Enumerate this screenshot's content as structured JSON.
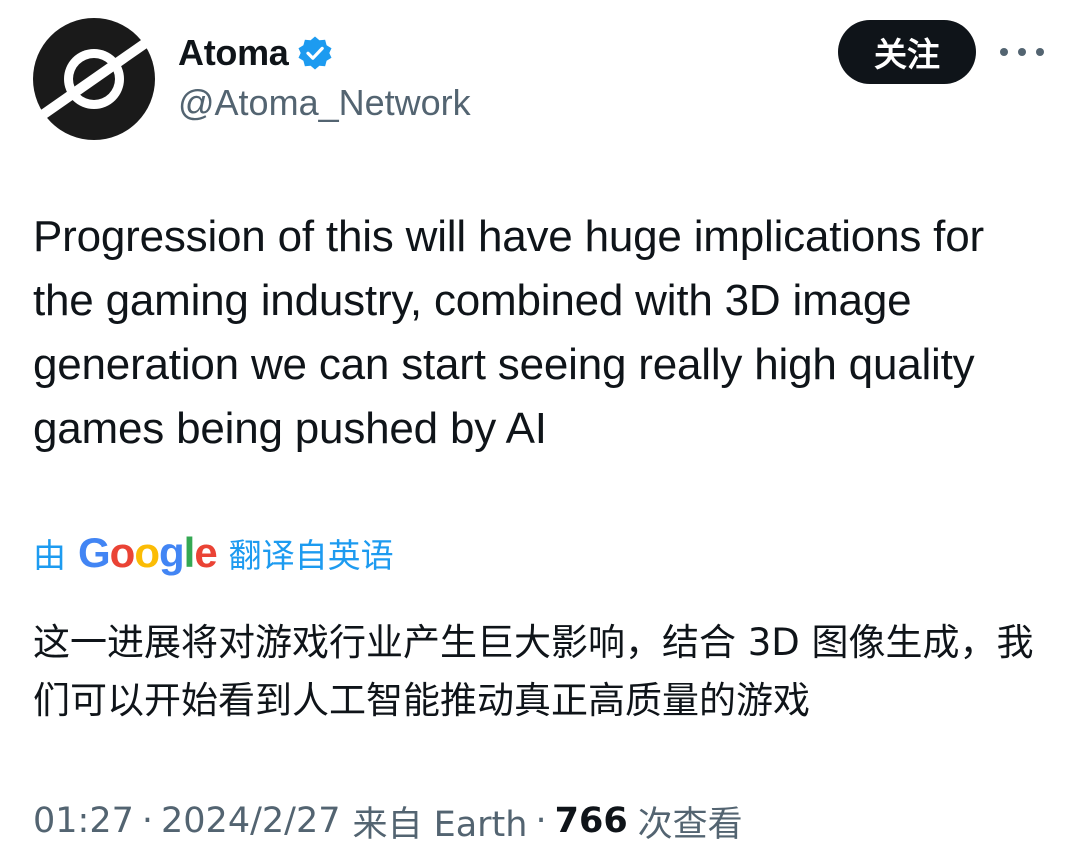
{
  "author": {
    "display_name": "Atoma",
    "handle": "@Atoma_Network",
    "verified": true,
    "avatar_icon": "atoma-logo",
    "verified_icon": "verified-badge-icon",
    "verified_color": "#1d9bf0"
  },
  "actions": {
    "follow_label": "关注",
    "more_icon": "more-horizontal-icon"
  },
  "tweet": {
    "text": "Progression of this will have huge implications for the gaming industry, combined with 3D image generation we can start seeing really high quality games being pushed by AI"
  },
  "translation": {
    "by_label": "由",
    "provider": "Google",
    "from_label": "翻译自英语",
    "text": "这一进展将对游戏行业产生巨大影响，结合 3D 图像生成，我们可以开始看到人工智能推动真正高质量的游戏"
  },
  "meta": {
    "time": "01:27",
    "separator": "·",
    "date": "2024/2/27",
    "source": "来自 Earth",
    "views_count": "766",
    "views_label": "次查看"
  },
  "colors": {
    "accent": "#1d9bf0",
    "text_primary": "#0f1419",
    "text_secondary": "#536471",
    "button_bg": "#0f1419"
  }
}
